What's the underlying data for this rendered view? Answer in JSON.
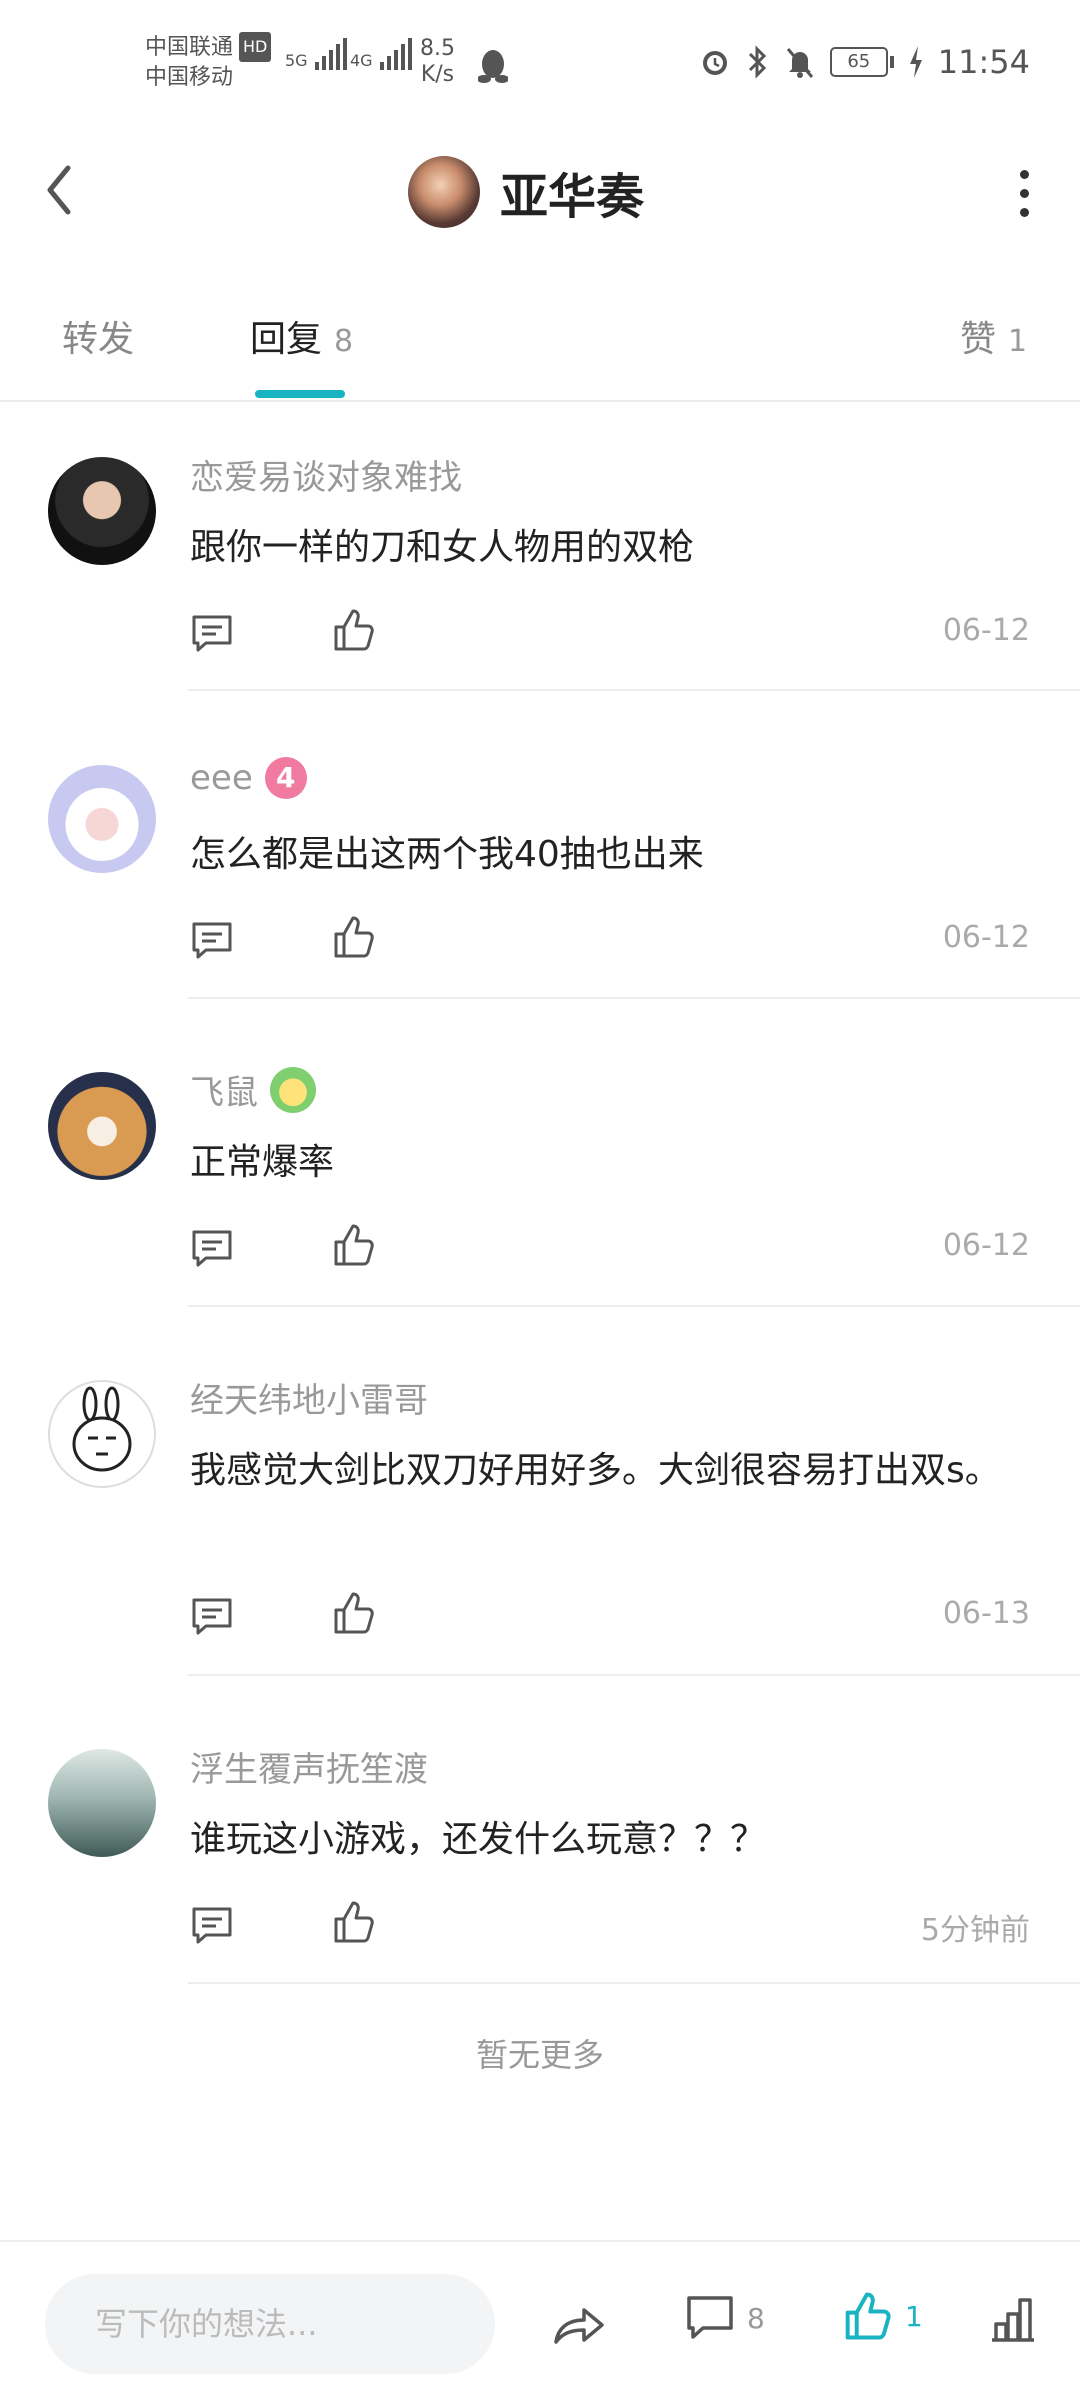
{
  "status_bar": {
    "carrier1": "中国联通",
    "carrier2": "中国移动",
    "hd": "HD",
    "net1": "5G",
    "net2": "4G",
    "speed_value": "8.5",
    "speed_unit": "K/s",
    "battery": "65",
    "time": "11:54"
  },
  "header": {
    "title": "亚华奏"
  },
  "tabs": [
    {
      "label": "转发",
      "count": ""
    },
    {
      "label": "回复",
      "count": "8"
    },
    {
      "label": "赞",
      "count": "1"
    }
  ],
  "comments": [
    {
      "name": "恋爱易谈对象难找",
      "text": "跟你一样的刀和女人物用的双枪",
      "time": "06-12",
      "badge": ""
    },
    {
      "name": "eee",
      "text": "怎么都是出这两个我40抽也出来",
      "time": "06-12",
      "badge": "4"
    },
    {
      "name": "飞鼠",
      "text": "正常爆率",
      "time": "06-12",
      "badge": ""
    },
    {
      "name": "经天纬地小雷哥",
      "text": "我感觉大剑比双刀好用好多。大剑很容易打出双s。",
      "time": "06-13",
      "badge": ""
    },
    {
      "name": "浮生覆声抚笙渡",
      "text": "谁玩这小游戏，还发什么玩意？？？",
      "time": "5分钟前",
      "badge": ""
    }
  ],
  "footer_note": "暂无更多",
  "bottom_bar": {
    "input_placeholder": "写下你的想法...",
    "comment_count": "8",
    "like_count": "1"
  },
  "colors": {
    "accent": "#19b3c1",
    "level_badge": "#f07aa0"
  }
}
